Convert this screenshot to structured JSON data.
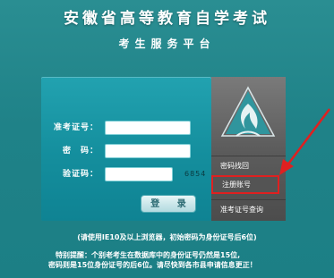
{
  "header": {
    "title": "安徽省高等教育自学考试",
    "subtitle": "考生服务平台"
  },
  "login_form": {
    "id_label": "准考证号：",
    "id_value": "",
    "password_label": "密　码：",
    "password_value": "",
    "captcha_label": "验证码：",
    "captcha_value": "",
    "captcha_code": "6854",
    "login_button": "登 录"
  },
  "side_menu": {
    "items": [
      {
        "label": "密码找回"
      },
      {
        "label": "注册账号"
      },
      {
        "label": "准考证号查询"
      }
    ]
  },
  "notices": {
    "browser_tip": "(请使用IE10及以上浏览器，初始密码为身份证号后6位)",
    "special_line_1": "特别提醒：个别老考生在数据库中的身份证号仍然是15位,",
    "special_line_2": "密码则是15位身份证号的后6位。请尽快到各市县申请信息更正！"
  },
  "colors": {
    "background": "#1f8288",
    "panel": "#148e9d",
    "side_panel": "#5a5a5a",
    "highlight": "#e02020"
  }
}
